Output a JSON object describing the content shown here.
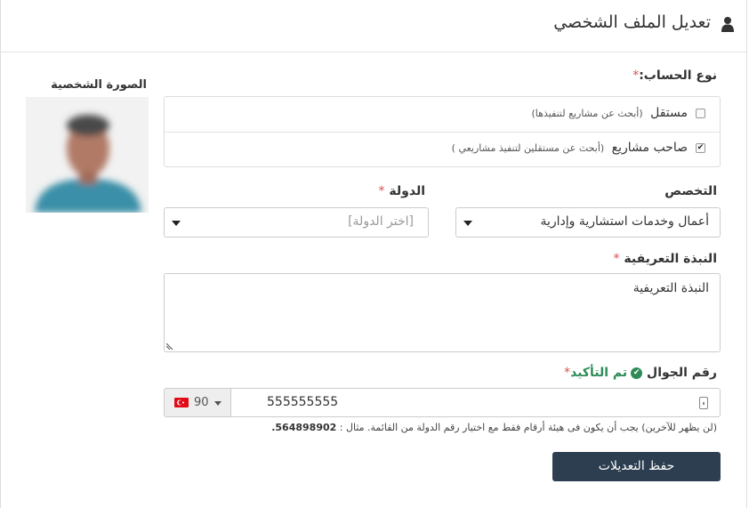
{
  "header": {
    "title": "تعديل الملف الشخصي",
    "icon": "user-icon"
  },
  "photo": {
    "label": "الصورة الشخصية"
  },
  "account_type": {
    "label": "نوع الحساب:",
    "required_mark": "*",
    "options": [
      {
        "label": "مستقل",
        "hint": "(أبحث عن مشاريع لتنفيذها)",
        "checked": false
      },
      {
        "label": "صاحب مشاريع",
        "hint": "(أبحث عن مستقلين لتنفيذ مشاريعي )",
        "checked": true
      }
    ]
  },
  "specialty": {
    "label": "التخصص",
    "value": "أعمال وخدمات استشارية وإدارية"
  },
  "country": {
    "label": "الدولة",
    "required_mark": "*",
    "placeholder": "[اختر الدولة]"
  },
  "bio": {
    "label": "النبذة التعريفية",
    "required_mark": "*",
    "placeholder": "النبذة التعريفية"
  },
  "mobile": {
    "label": "رقم الجوال",
    "verified_text": "تم التأكيد",
    "required_mark": "*",
    "country_code": "90",
    "value": "555555555",
    "help_text": "(لن يظهر للآخرين) يجب أن يكون فى هيئة أرقام فقط مع اختيار رقم الدولة من القائمة. مثال :",
    "help_example": "564898902."
  },
  "actions": {
    "save_label": "حفظ التعديلات"
  },
  "colors": {
    "accent_button": "#2c3e50",
    "required": "#d9534f",
    "verified": "#2e8b57"
  }
}
